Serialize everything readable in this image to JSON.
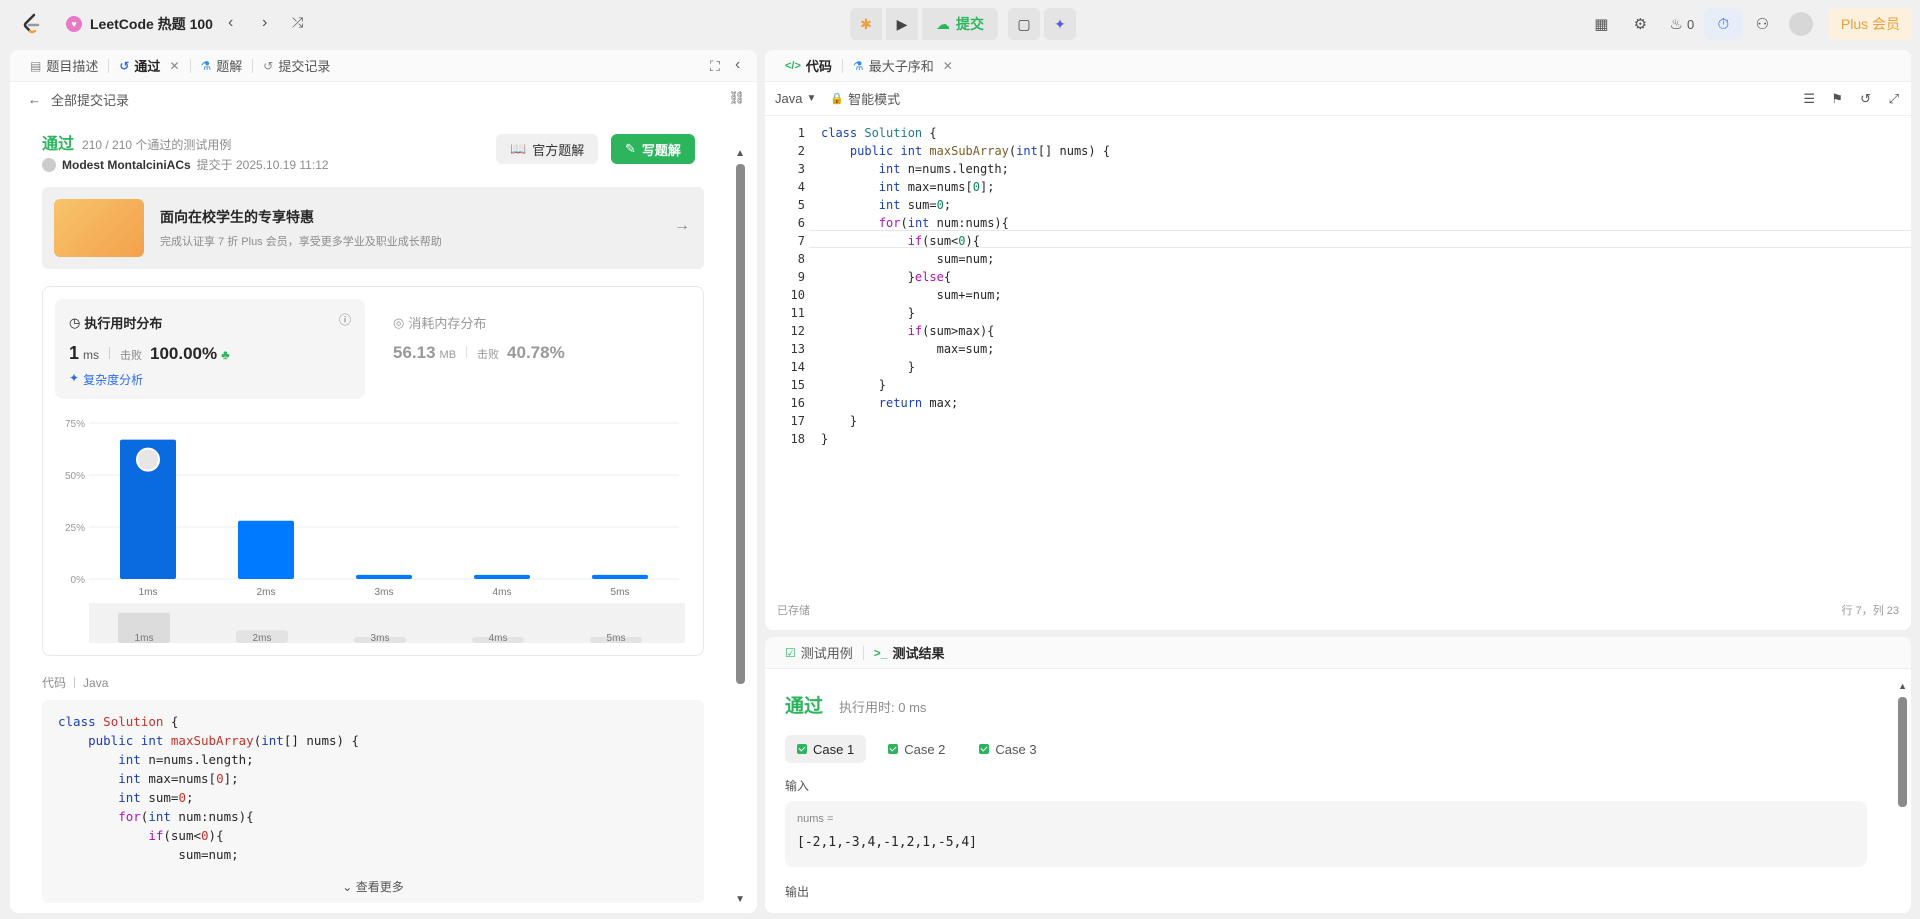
{
  "topbar": {
    "title": "LeetCode 热题 100",
    "submit_label": "提交",
    "streak_count": "0",
    "plus_label": "Plus 会员"
  },
  "left": {
    "tabs": [
      {
        "label": "题目描述"
      },
      {
        "label": "通过"
      },
      {
        "label": "题解"
      },
      {
        "label": "提交记录"
      }
    ],
    "back_label": "全部提交记录",
    "result": {
      "status": "通过",
      "testcases": "210 / 210 个通过的测试用例",
      "author": "Modest MontalciniACs",
      "submitted": "提交于 2025.10.19 11:12",
      "official_btn": "官方题解",
      "write_btn": "写题解"
    },
    "promo": {
      "title": "面向在校学生的专享特惠",
      "desc": "完成认证享 7 折 Plus 会员，享受更多学业及职业成长帮助"
    },
    "runtime": {
      "title": "执行用时分布",
      "value": "1",
      "unit": "ms",
      "beat_label": "击败",
      "beat": "100.00%",
      "complexity": "复杂度分析"
    },
    "memory": {
      "title": "消耗内存分布",
      "value": "56.13",
      "unit": "MB",
      "beat_label": "击败",
      "beat": "40.78%"
    },
    "code_header": {
      "label": "代码",
      "lang": "Java"
    },
    "code_lines": [
      "class Solution {",
      "    public int maxSubArray(int[] nums) {",
      "        int n=nums.length;",
      "        int max=nums[0];",
      "        int sum=0;",
      "        for(int num:nums){",
      "            if(sum<0){",
      "                sum=num;"
    ],
    "see_more": "查看更多"
  },
  "chart_data": {
    "type": "bar",
    "categories": [
      "1ms",
      "2ms",
      "3ms",
      "4ms",
      "5ms"
    ],
    "values": [
      67,
      28,
      2,
      2,
      2
    ],
    "yticks": [
      "75%",
      "50%",
      "25%",
      "0%"
    ],
    "ylim": [
      0,
      75
    ],
    "minimap_categories": [
      "1ms",
      "2ms",
      "3ms",
      "4ms",
      "5ms"
    ],
    "color": "#007aff",
    "highlight_color": "#0a6be0"
  },
  "editor": {
    "tabs": [
      {
        "label": "代码"
      },
      {
        "label": "最大子序和"
      }
    ],
    "lang": "Java",
    "mode": "智能模式",
    "saved": "已存储",
    "cursor": "行 7，列 23",
    "lines": [
      "class Solution {",
      "    public int maxSubArray(int[] nums) {",
      "        int n=nums.length;",
      "        int max=nums[0];",
      "        int sum=0;",
      "        for(int num:nums){",
      "            if(sum<0){",
      "                sum=num;",
      "            }else{",
      "                sum+=num;",
      "            }",
      "            if(sum>max){",
      "                max=sum;",
      "            }",
      "        }",
      "        return max;",
      "    }",
      "}"
    ]
  },
  "testpanel": {
    "tabs": [
      {
        "label": "测试用例"
      },
      {
        "label": "测试结果"
      }
    ],
    "status": "通过",
    "runtime": "执行用时: 0 ms",
    "cases": [
      "Case 1",
      "Case 2",
      "Case 3"
    ],
    "input_label": "输入",
    "param_name": "nums =",
    "param_value": "[-2,1,-3,4,-1,2,1,-5,4]",
    "output_label": "输出"
  }
}
